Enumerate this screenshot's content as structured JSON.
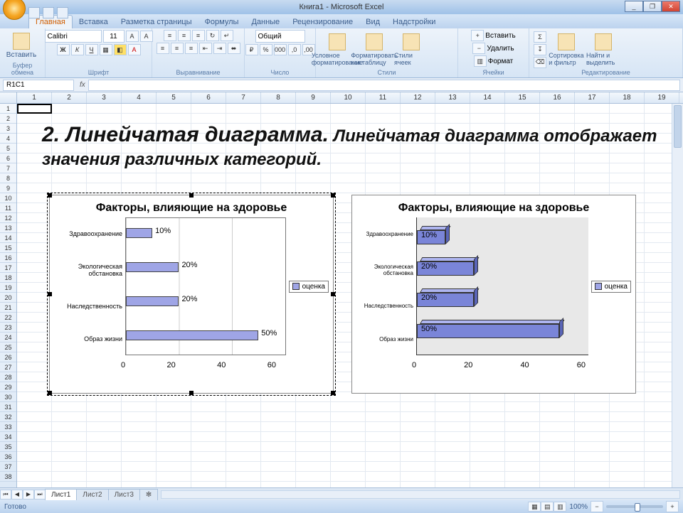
{
  "window": {
    "title": "Книга1 - Microsoft Excel",
    "min": "_",
    "max": "❐",
    "close": "✕"
  },
  "ribbon_tabs": [
    "Главная",
    "Вставка",
    "Разметка страницы",
    "Формулы",
    "Данные",
    "Рецензирование",
    "Вид",
    "Надстройки"
  ],
  "active_tab": "Главная",
  "ribbon_groups": {
    "clipboard": "Буфер обмена",
    "paste": "Вставить",
    "font": "Шрифт",
    "font_name": "Calibri",
    "font_size": "11",
    "alignment": "Выравнивание",
    "number": "Число",
    "number_format": "Общий",
    "styles": "Стили",
    "cond": "Условное форматирование",
    "table": "Форматировать как таблицу",
    "cellstyles": "Стили ячеек",
    "cells": "Ячейки",
    "insert": "Вставить",
    "delete": "Удалить",
    "format": "Формат",
    "editing": "Редактирование",
    "sort": "Сортировка и фильтр",
    "find": "Найти и выделить"
  },
  "name_box": "R1C1",
  "fx": "fx",
  "columns": [
    "1",
    "2",
    "3",
    "4",
    "5",
    "6",
    "7",
    "8",
    "9",
    "10",
    "11",
    "12",
    "13",
    "14",
    "15",
    "16",
    "17",
    "18",
    "19"
  ],
  "rows": [
    "1",
    "2",
    "3",
    "4",
    "5",
    "6",
    "7",
    "8",
    "9",
    "10",
    "11",
    "12",
    "13",
    "14",
    "15",
    "16",
    "17",
    "18",
    "19",
    "20",
    "21",
    "22",
    "23",
    "24",
    "25",
    "26",
    "27",
    "28",
    "29",
    "30",
    "31",
    "32",
    "33",
    "34",
    "35",
    "36",
    "37",
    "38"
  ],
  "headline_num": "2. ",
  "headline_big": "Линейчатая диаграмма.",
  "headline_rest": " Линейчатая диаграмма отображает значения различных категорий.",
  "sheets": [
    "Лист1",
    "Лист2",
    "Лист3"
  ],
  "status": "Готово",
  "zoom": "100%",
  "chart_data": [
    {
      "type": "bar",
      "orientation": "horizontal",
      "title": "Факторы, влияющие на здоровье",
      "categories": [
        "Здравоохранение",
        "Экологическая обстановка",
        "Наследственность",
        "Образ жизни"
      ],
      "values": [
        10,
        20,
        20,
        50
      ],
      "value_labels": [
        "10%",
        "20%",
        "20%",
        "50%"
      ],
      "xlim": [
        0,
        60
      ],
      "xticks": [
        0,
        20,
        40,
        60
      ],
      "legend": [
        "оценка"
      ]
    },
    {
      "type": "bar",
      "orientation": "horizontal",
      "style": "3d",
      "title": "Факторы, влияющие на здоровье",
      "categories": [
        "Здравоохранение",
        "Экологическая обстановка",
        "Наследственность",
        "Образ жизни"
      ],
      "values": [
        10,
        20,
        20,
        50
      ],
      "value_labels": [
        "10%",
        "20%",
        "20%",
        "50%"
      ],
      "xlim": [
        0,
        60
      ],
      "xticks": [
        0,
        20,
        40,
        60
      ],
      "legend": [
        "оценка"
      ]
    }
  ]
}
